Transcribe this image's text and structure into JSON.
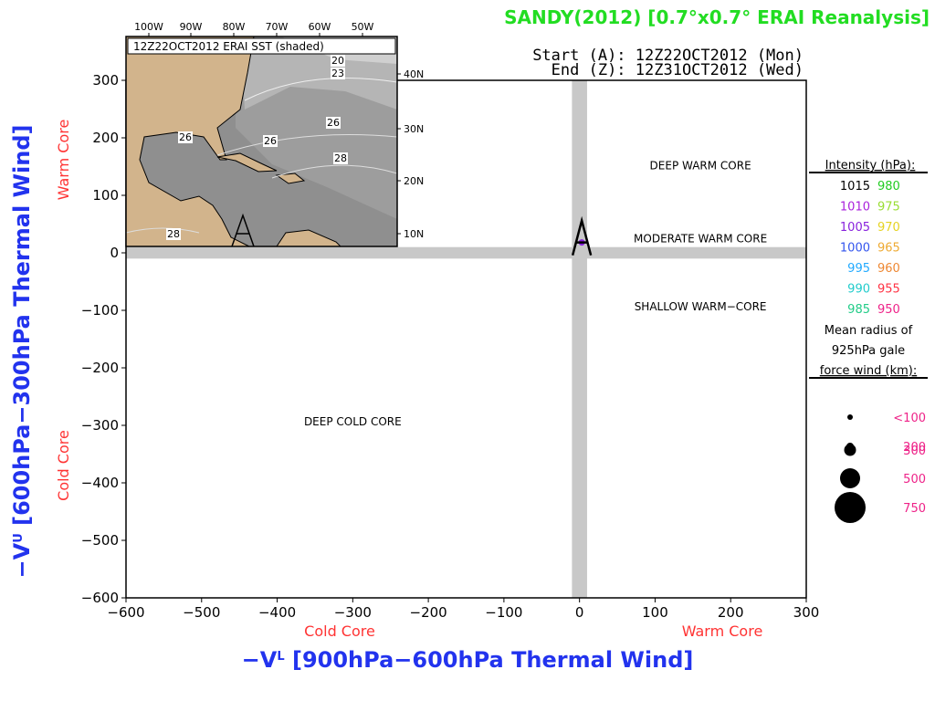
{
  "chart_data": {
    "type": "scatter",
    "title": "SANDY(2012) [0.7°x0.7° ERAI Reanalysis]",
    "title_color": "#22dd22",
    "start_label": "Start (A): 12Z22OCT2012 (Mon)",
    "end_label": "End (Z): 12Z31OCT2012 (Wed)",
    "xlabel": "−Vₜᴸ [900hPa−600hPa Thermal Wind]",
    "xlabel_text": "[900hPa−600hPa Thermal Wind]",
    "xlabel_prefix": "−V",
    "xlabel_super": "L",
    "ylabel_text": "[600hPa−300hPa Thermal Wind]",
    "ylabel_prefix": "−V",
    "ylabel_super": "U",
    "axis_label_color": "#2233ee",
    "xlim": [
      -600,
      300
    ],
    "ylim": [
      -600,
      300
    ],
    "xticks": [
      -600,
      -500,
      -400,
      -300,
      -200,
      -100,
      0,
      100,
      200,
      300
    ],
    "yticks": [
      -600,
      -500,
      -400,
      -300,
      -200,
      -100,
      0,
      100,
      200,
      300
    ],
    "xtick_labels": [
      "−600",
      "−500",
      "−400",
      "−300",
      "−200",
      "−100",
      "0",
      "100",
      "200",
      "300"
    ],
    "ytick_labels": [
      "−600",
      "−500",
      "−400",
      "−300",
      "−200",
      "−100",
      "0",
      "100",
      "200",
      "300"
    ],
    "x_core_labels": {
      "cold": "Cold Core",
      "warm": "Warm Core"
    },
    "y_core_labels": {
      "cold": "Cold Core",
      "warm": "Warm Core"
    },
    "core_label_color": "#ff3333",
    "regions": [
      {
        "label": "DEEP WARM CORE",
        "x": 160,
        "y": 145
      },
      {
        "label": "MODERATE WARM CORE",
        "x": 160,
        "y": 18
      },
      {
        "label": "SHALLOW WARM−CORE",
        "x": 160,
        "y": -100
      },
      {
        "label": "DEEP COLD CORE",
        "x": -300,
        "y": -300
      }
    ],
    "points": [
      {
        "x": 3,
        "y": 18,
        "pressure_hPa": 1007,
        "color": "#8822dd",
        "radius_class": "<100",
        "marker": "A"
      }
    ],
    "legend": {
      "intensity_title": "Intensity (hPa):",
      "intensity": [
        {
          "value": "1015",
          "color": "#000000"
        },
        {
          "value": "980",
          "color": "#22cc22"
        },
        {
          "value": "1010",
          "color": "#aa22dd"
        },
        {
          "value": "975",
          "color": "#99dd33"
        },
        {
          "value": "1005",
          "color": "#8822dd"
        },
        {
          "value": "970",
          "color": "#e6d322"
        },
        {
          "value": "1000",
          "color": "#3355ee"
        },
        {
          "value": "965",
          "color": "#eeaa33"
        },
        {
          "value": "995",
          "color": "#22aaff"
        },
        {
          "value": "960",
          "color": "#ee8833"
        },
        {
          "value": "990",
          "color": "#22cccc"
        },
        {
          "value": "955",
          "color": "#ff3344"
        },
        {
          "value": "985",
          "color": "#22cc88"
        },
        {
          "value": "950",
          "color": "#ee2288"
        }
      ],
      "radius_title_lines": [
        "Mean radius of",
        "925hPa gale",
        "force wind (km):"
      ],
      "radius": [
        {
          "label": "<100",
          "size": 1
        },
        {
          "label": "200",
          "size": 2
        },
        {
          "label": "300",
          "size": 3
        },
        {
          "label": "500",
          "size": 4
        },
        {
          "label": "750",
          "size": 5
        }
      ],
      "radius_label_color": "#ee2288"
    },
    "inset_map": {
      "title": "12Z22OCT2012 ERAI SST (shaded)",
      "lon_labels": [
        "100W",
        "90W",
        "80W",
        "70W",
        "60W",
        "50W"
      ],
      "lat_labels": [
        "40N",
        "30N",
        "20N",
        "10N"
      ],
      "contour_labels": [
        "20",
        "23",
        "26",
        "26",
        "26",
        "28",
        "28"
      ],
      "start_marker": "A"
    }
  }
}
